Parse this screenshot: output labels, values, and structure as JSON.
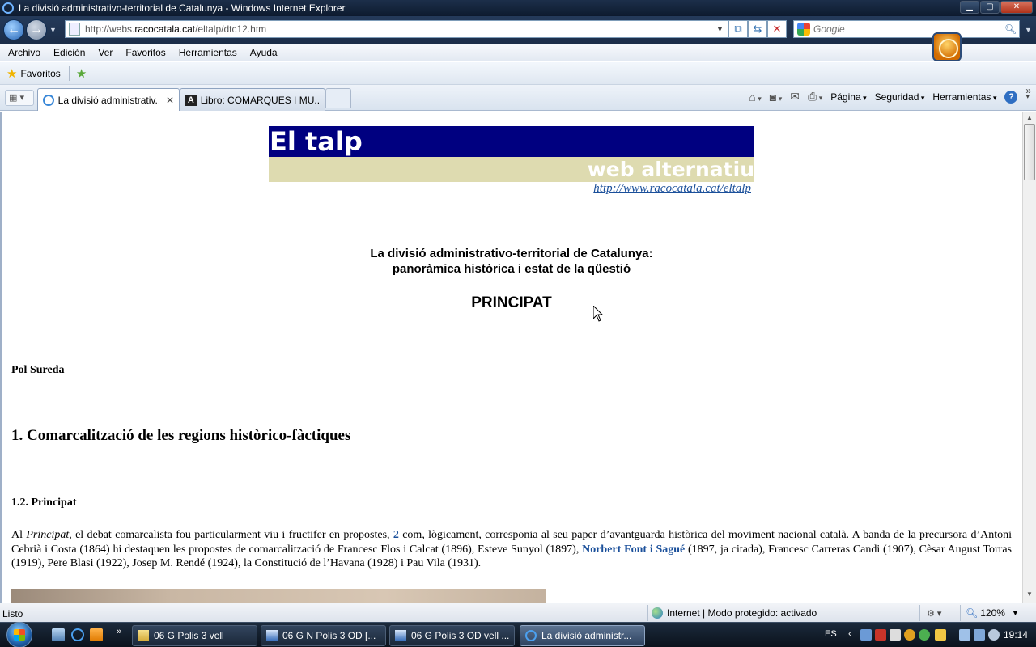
{
  "window": {
    "title": "La divisió administrativo-territorial de Catalunya - Windows Internet Explorer",
    "buttons": [
      "minimize",
      "maximize",
      "close"
    ]
  },
  "address_bar": {
    "url_prefix": "http://webs.",
    "url_domain": "racocatala.cat",
    "url_path": "/eltalp/dtc12.htm",
    "search_placeholder": "Google"
  },
  "menu": {
    "items": [
      "Archivo",
      "Edición",
      "Ver",
      "Favoritos",
      "Herramientas",
      "Ayuda"
    ]
  },
  "favorites_bar": {
    "label": "Favoritos"
  },
  "tabs": [
    {
      "label": "La divisió administrativ...",
      "active": true
    },
    {
      "label": "Libro: COMARQUES I MU...",
      "active": false
    }
  ],
  "command_bar": {
    "pagina": "Página",
    "seguridad": "Seguridad",
    "herramientas": "Herramientas",
    "help": "?"
  },
  "page": {
    "banner_title": "El talp",
    "banner_subtitle": "web alternatiu",
    "site_link": "http://www.racocatala.cat/eltalp",
    "title_line1": "La divisió administrativo-territorial de Catalunya:",
    "title_line2": "panoràmica històrica i estat de la qüestió",
    "section_label": "PRINCIPAT",
    "author": "Pol Sureda",
    "heading1": "1. Comarcalització de les regions històrico-fàctiques",
    "heading2": "1.2. Principat",
    "para_al": "Al ",
    "para_principat": "Principat",
    "para_part1": ", el debat comarcalista fou particularment viu i fructifer en propostes, ",
    "para_link_note": "2",
    "para_part2": "  com, lògicament, corresponia al seu paper d’avantguarda històrica del moviment nacional català. A  banda de la precursora d’Antoni Cebrià i Costa (1864) hi destaquen les propostes de comarcalització de Francesc Flos i Calcat (1896), Esteve Sunyol (1897), ",
    "para_link_person": "Norbert Font i Sagué",
    "para_part3": " (1897, ja citada), Francesc Carreras Candi (1907), Cèsar August Torras (1919), Pere Blasi (1922), Josep M. Rendé (1924), la Constitució de l’Havana (1928) i Pau Vila (1931)."
  },
  "status_bar": {
    "status": "Listo",
    "zone": "Internet | Modo protegido: activado",
    "zoom": "120%"
  },
  "taskbar": {
    "tasks": [
      {
        "label": "06 G Polis 3 vell",
        "icon": "folder-icon",
        "active": false
      },
      {
        "label": "06 G N Polis 3 OD [...",
        "icon": "word-icon",
        "active": false
      },
      {
        "label": "06 G Polis 3 OD vell ...",
        "icon": "word-icon",
        "active": false
      },
      {
        "label": "La divisió administr...",
        "icon": "ie-icon",
        "active": true
      }
    ],
    "language": "ES",
    "clock": "19:14"
  },
  "colors": {
    "banner_top": "#000080",
    "banner_bottom": "#dedbb0",
    "link": "#1a4f9a"
  }
}
